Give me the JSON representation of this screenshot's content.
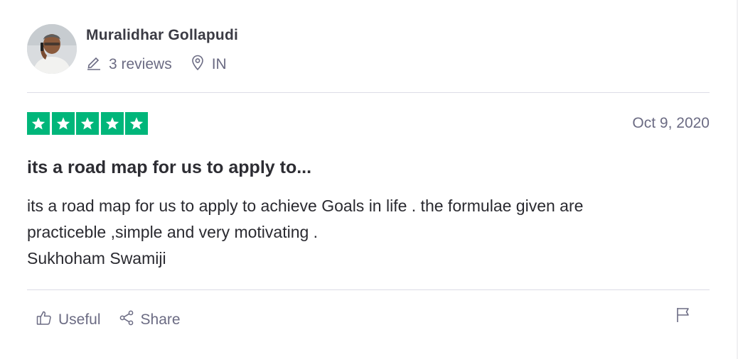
{
  "reviewer": {
    "name": "Muralidhar Gollapudi",
    "reviews_count": "3 reviews",
    "country": "IN"
  },
  "review": {
    "rating": 5,
    "rating_max": 5,
    "star_color": "#00b67a",
    "date": "Oct 9, 2020",
    "title": "its a road map for us to apply to...",
    "body_lines": [
      "its a road map for us to apply to achieve Goals in life . the formulae given are",
      "practiceble ,simple and very motivating .",
      "Sukhoham Swamiji"
    ]
  },
  "actions": {
    "useful_label": "Useful",
    "share_label": "Share"
  },
  "icons": {
    "reviews": "pencil-icon",
    "location": "location-pin-icon",
    "useful": "thumbs-up-icon",
    "share": "share-icon",
    "report": "flag-icon",
    "star": "star-icon"
  }
}
